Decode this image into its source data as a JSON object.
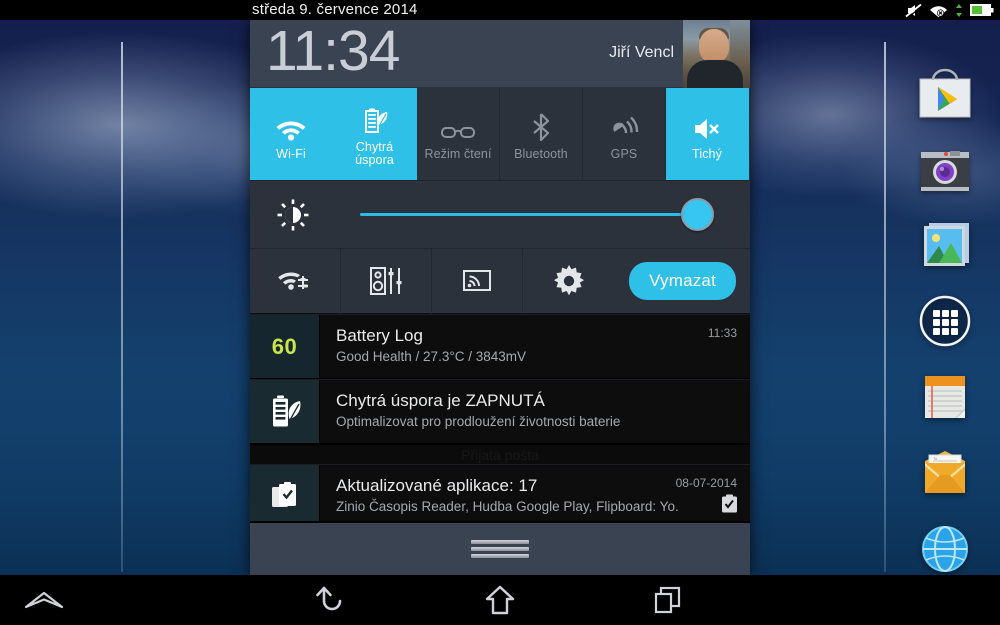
{
  "statusbar": {
    "date": "středa 9. července 2014",
    "icons": [
      {
        "name": "silent-mode-icon",
        "label": "mute"
      },
      {
        "name": "wifi-no-internet-icon",
        "label": "wifi"
      },
      {
        "name": "data-transfer-icon",
        "label": "updown"
      },
      {
        "name": "battery-icon",
        "label": "battery"
      }
    ]
  },
  "shade": {
    "clock": "11:34",
    "user": "Jiří Vencl",
    "avatar_name": "user-avatar",
    "toggles": [
      {
        "label": "Wi-Fi",
        "icon": "wifi-icon",
        "state": "on"
      },
      {
        "label": "Chytrá\núspora",
        "label_line1": "Chytrá",
        "label_line2": "úspora",
        "icon": "power-saving-icon",
        "state": "on"
      },
      {
        "label": "Režim čtení",
        "icon": "reading-mode-glasses-icon",
        "state": "off"
      },
      {
        "label": "Bluetooth",
        "icon": "bluetooth-icon",
        "state": "off"
      },
      {
        "label": "GPS",
        "icon": "gps-icon",
        "state": "off"
      },
      {
        "label": "Tichý",
        "icon": "sound-mute-icon",
        "state": "on"
      }
    ],
    "brightness": {
      "icon": "brightness-icon",
      "value": 96,
      "accent": "#2fc0e8"
    },
    "actions": [
      {
        "name": "wifi-settings-icon"
      },
      {
        "name": "audio-equalizer-icon"
      },
      {
        "name": "screen-mirroring-icon"
      },
      {
        "name": "settings-gear-icon"
      }
    ],
    "clear_label": "Vymazat",
    "hidden_notification_text": "Přijatá pošta",
    "grip_name": "drag-handle"
  },
  "notifications": [
    {
      "icon": "battery-level-icon",
      "badge": "60",
      "title": "Battery Log",
      "subtitle": "Good Health / 27.3°C / 3843mV",
      "time": "11:33",
      "action_icon": ""
    },
    {
      "icon": "power-saving-battery-leaf-icon",
      "badge": "",
      "title": "Chytrá úspora je ZAPNUTÁ",
      "subtitle": "Optimalizovat pro prodloužení životnosti baterie",
      "time": "",
      "action_icon": ""
    },
    {
      "icon": "app-updates-icon",
      "badge": "",
      "title": "Aktualizované aplikace: 17",
      "subtitle": "Zinio Časopis Reader, Hudba Google Play, Flipboard: Yo.",
      "time": "08-07-2014",
      "action_icon": "clipboard-check-icon"
    }
  ],
  "dock": [
    {
      "name": "play-store-icon"
    },
    {
      "name": "camera-icon"
    },
    {
      "name": "gallery-icon"
    },
    {
      "name": "app-drawer-icon"
    },
    {
      "name": "notes-icon"
    },
    {
      "name": "email-icon"
    },
    {
      "name": "browser-icon"
    }
  ],
  "navbar": [
    {
      "name": "notification-peek-button",
      "icon": "chevron-up-outline-icon"
    },
    {
      "name": "back-button",
      "icon": "back-arrow-icon"
    },
    {
      "name": "home-button",
      "icon": "home-icon"
    },
    {
      "name": "recents-button",
      "icon": "recents-icon"
    }
  ],
  "colors": {
    "accent": "#2fc0e8",
    "panel": "#2c323c",
    "header": "#3a4352",
    "battery_badge": "#c8e64a"
  }
}
